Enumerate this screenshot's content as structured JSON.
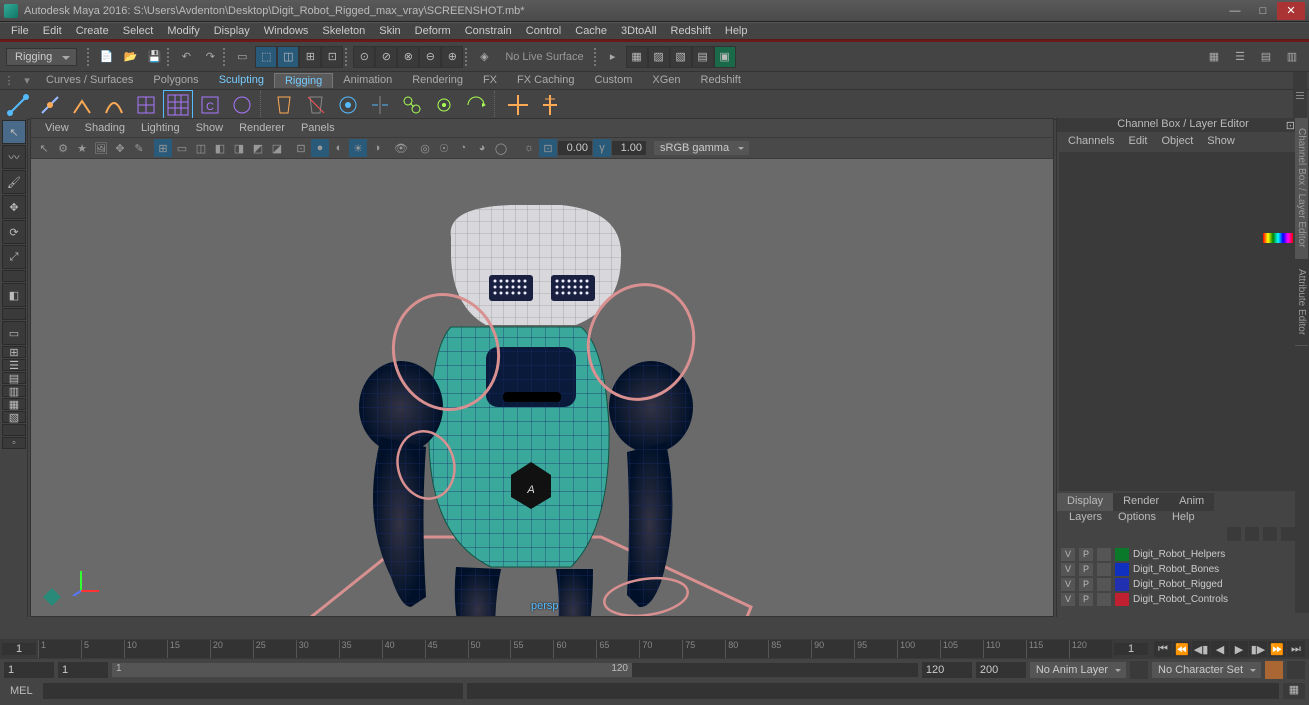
{
  "titlebar": {
    "app": "Autodesk Maya 2016: ",
    "path": "S:\\Users\\Avdenton\\Desktop\\Digit_Robot_Rigged_max_vray\\SCREENSHOT.mb*"
  },
  "menu": [
    "File",
    "Edit",
    "Create",
    "Select",
    "Modify",
    "Display",
    "Windows",
    "Skeleton",
    "Skin",
    "Deform",
    "Constrain",
    "Control",
    "Cache",
    "3DtoAll",
    "Redshift",
    "Help"
  ],
  "mode": "Rigging",
  "nolive": "No Live Surface",
  "shelfTabs": [
    "Curves / Surfaces",
    "Polygons",
    "Sculpting",
    "Rigging",
    "Animation",
    "Rendering",
    "FX",
    "FX Caching",
    "Custom",
    "XGen",
    "Redshift"
  ],
  "shelfActive": "Rigging",
  "vpMenu": [
    "View",
    "Shading",
    "Lighting",
    "Show",
    "Renderer",
    "Panels"
  ],
  "vpExposure": "0.00",
  "vpGamma": "1.00",
  "vpColor": "sRGB gamma",
  "persp": "persp",
  "channelBox": {
    "title": "Channel Box / Layer Editor",
    "menu": [
      "Channels",
      "Edit",
      "Object",
      "Show"
    ]
  },
  "layerTabs": [
    "Display",
    "Render",
    "Anim"
  ],
  "layerActive": "Display",
  "layerMenu": [
    "Layers",
    "Options",
    "Help"
  ],
  "layers": [
    {
      "v": "V",
      "p": "P",
      "color": "#0a7a2a",
      "name": "Digit_Robot_Helpers"
    },
    {
      "v": "V",
      "p": "P",
      "color": "#1030c0",
      "name": "Digit_Robot_Bones"
    },
    {
      "v": "V",
      "p": "P",
      "color": "#2030b0",
      "name": "Digit_Robot_Rigged"
    },
    {
      "v": "V",
      "p": "P",
      "color": "#c02030",
      "name": "Digit_Robot_Controls"
    }
  ],
  "timeline": {
    "start": "1",
    "ticks": [
      "1",
      "5",
      "10",
      "15",
      "20",
      "25",
      "30",
      "35",
      "40",
      "45",
      "50",
      "55",
      "60",
      "65",
      "70",
      "75",
      "80",
      "85",
      "90",
      "95",
      "100",
      "105",
      "110",
      "115",
      "120"
    ],
    "end": "1"
  },
  "range": {
    "s1": "1",
    "s2": "1",
    "hs": "1",
    "he": "120",
    "e1": "120",
    "e2": "200",
    "animLayer": "No Anim Layer",
    "charSet": "No Character Set"
  },
  "cmd": {
    "lang": "MEL"
  },
  "vertTabs": [
    "Channel Box / Layer Editor",
    "Attribute Editor"
  ]
}
